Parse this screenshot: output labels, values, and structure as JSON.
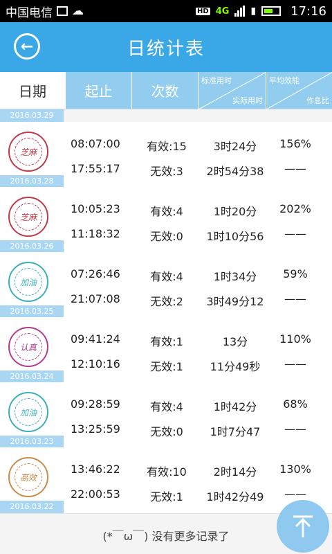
{
  "status": {
    "carrier": "中国电信",
    "network": "4G",
    "time": "17:16"
  },
  "title_bar": {
    "title": "日统计表"
  },
  "header": {
    "date": "日期",
    "qizhi": "起止",
    "cishu": "次数",
    "yongshi_top": "标准用时",
    "yongshi_bottom": "实际用时",
    "pingjun_top": "平均效能",
    "pingjun_bottom": "作息比"
  },
  "top_date_tag": "2016.03.29",
  "rows": [
    {
      "date": "2016.03.28",
      "start": "08:07:00",
      "end": "17:55:17",
      "valid": "有效:15",
      "invalid": "无效:3",
      "std": "3时24分",
      "actual": "2时54分38",
      "pct": "156%",
      "dash": "——",
      "stamp_color": "#c0394a",
      "stamp_text": "芝麻"
    },
    {
      "date": "2016.03.26",
      "start": "10:05:23",
      "end": "11:18:32",
      "valid": "有效:4",
      "invalid": "无效:0",
      "std": "1时20分",
      "actual": "1时10分56",
      "pct": "202%",
      "dash": "——",
      "stamp_color": "#c0394a",
      "stamp_text": "芝麻"
    },
    {
      "date": "2016.03.25",
      "start": "07:26:46",
      "end": "21:07:08",
      "valid": "有效:4",
      "invalid": "无效:2",
      "std": "1时34分",
      "actual": "3时49分12",
      "pct": "59%",
      "dash": "——",
      "stamp_color": "#3bb0b8",
      "stamp_text": "加油"
    },
    {
      "date": "2016.03.24",
      "start": "09:41:24",
      "end": "12:10:16",
      "valid": "有效:1",
      "invalid": "无效:1",
      "std": "13分",
      "actual": "11分49秒",
      "pct": "110%",
      "dash": "——",
      "stamp_color": "#b23c8c",
      "stamp_text": "认真"
    },
    {
      "date": "2016.03.23",
      "start": "09:28:59",
      "end": "13:25:59",
      "valid": "有效:4",
      "invalid": "无效:0",
      "std": "1时42分",
      "actual": "1时7分47",
      "pct": "68%",
      "dash": "——",
      "stamp_color": "#3bb0b8",
      "stamp_text": "加油"
    },
    {
      "date": "2016.03.22",
      "start": "13:46:22",
      "end": "22:00:53",
      "valid": "有效:10",
      "invalid": "无效:1",
      "std": "2时14分",
      "actual": "1时42分49",
      "pct": "130%",
      "dash": "——",
      "stamp_color": "#c98a4a",
      "stamp_text": "高效"
    }
  ],
  "footer_text": "(*￣ω￣) 没有更多记录了"
}
